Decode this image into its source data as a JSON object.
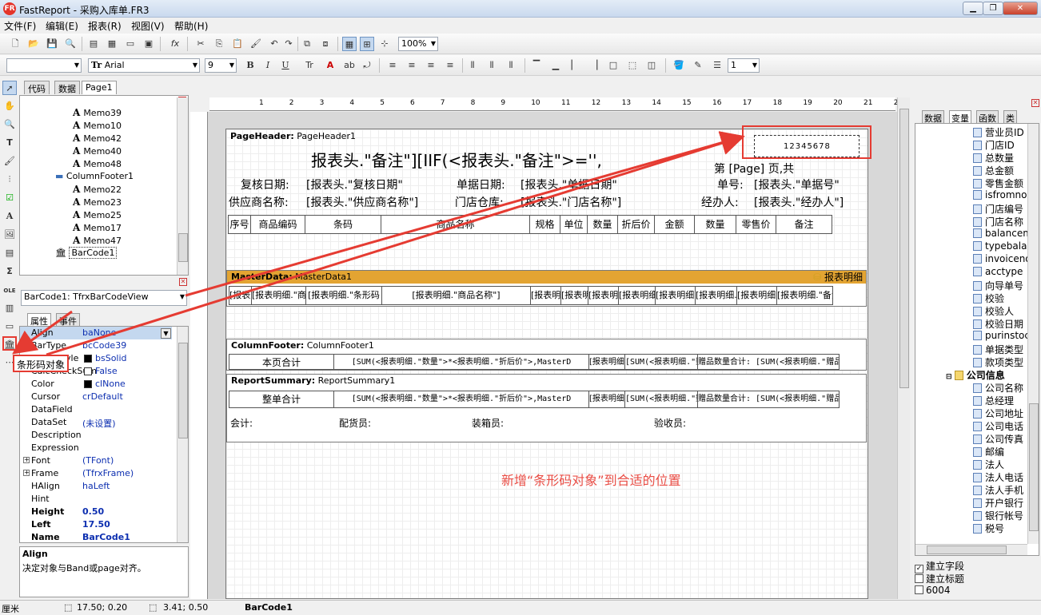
{
  "app": {
    "title": "FastReport - 采购入库单.FR3",
    "logo": "FR"
  },
  "menu": [
    "文件(F)",
    "编辑(E)",
    "报表(R)",
    "视图(V)",
    "帮助(H)"
  ],
  "toolbar1": {
    "zoom": "100%"
  },
  "toolbar2": {
    "style_value": "",
    "font": "Arial",
    "size": "9",
    "bold": "B",
    "italic": "I",
    "underline": "U",
    "line_width": "1"
  },
  "left_tabs": [
    "代码",
    "数据",
    "Page1"
  ],
  "tree_items": [
    {
      "label": "Memo39",
      "icon": "A"
    },
    {
      "label": "Memo10",
      "icon": "A"
    },
    {
      "label": "Memo42",
      "icon": "A"
    },
    {
      "label": "Memo40",
      "icon": "A"
    },
    {
      "label": "Memo48",
      "icon": "A"
    },
    {
      "label": "ColumnFooter1",
      "icon": "band"
    },
    {
      "label": "Memo22",
      "icon": "A"
    },
    {
      "label": "Memo23",
      "icon": "A"
    },
    {
      "label": "Memo25",
      "icon": "A"
    },
    {
      "label": "Memo17",
      "icon": "A"
    },
    {
      "label": "Memo47",
      "icon": "A"
    },
    {
      "label": "BarCode1",
      "icon": "barcode"
    }
  ],
  "object_selector": "BarCode1: TfrxBarCodeView",
  "prop_tabs": [
    "属性",
    "事件"
  ],
  "properties": [
    {
      "key": "Align",
      "value": "baNone"
    },
    {
      "key": "BarType",
      "value": "bcCode39"
    },
    {
      "key": "BrushStyle",
      "value": "bsSolid"
    },
    {
      "key": "CalcCheckSum",
      "value": "False"
    },
    {
      "key": "Color",
      "value": "clNone"
    },
    {
      "key": "Cursor",
      "value": "crDefault"
    },
    {
      "key": "DataField",
      "value": ""
    },
    {
      "key": "DataSet",
      "value": "(未设置)"
    },
    {
      "key": "Description",
      "value": ""
    },
    {
      "key": "Expression",
      "value": ""
    },
    {
      "key": "Font",
      "value": "(TFont)"
    },
    {
      "key": "Frame",
      "value": "(TfrxFrame)"
    },
    {
      "key": "HAlign",
      "value": "haLeft"
    },
    {
      "key": "Hint",
      "value": ""
    },
    {
      "key": "Height",
      "value": "0.50"
    },
    {
      "key": "Left",
      "value": "17.50"
    },
    {
      "key": "Name",
      "value": "BarCode1"
    }
  ],
  "help": {
    "title": "Align",
    "text": "决定对象与Band或page对齐。"
  },
  "callout": {
    "label": "条形码对象"
  },
  "ruler": [
    "1",
    "2",
    "3",
    "4",
    "5",
    "6",
    "7",
    "8",
    "9",
    "10",
    "11",
    "12",
    "13",
    "14",
    "15",
    "16",
    "17",
    "18",
    "19",
    "20",
    "21",
    "22"
  ],
  "bands": {
    "page_header": {
      "type": "PageHeader:",
      "name": "PageHeader1"
    },
    "master_data": {
      "type": "MasterData:",
      "name": "MasterData1",
      "dataset": "报表明细"
    },
    "column_footer": {
      "type": "ColumnFooter:",
      "name": "ColumnFooter1"
    },
    "report_summary": {
      "type": "ReportSummary:",
      "name": "ReportSummary1"
    }
  },
  "header_texts": {
    "title": "报表头.\"备注\"][IIF(<报表头.\"备注\">='',",
    "page_info": "第 [Page] 页,共",
    "review_date_label": "复核日期:",
    "review_date_value": "[报表头.\"复核日期\"",
    "doc_date_label": "单据日期:",
    "doc_date_value": "[报表头.\"单据日期\"",
    "doc_no_label": "单号:",
    "doc_no_value": "[报表头.\"单据号\"",
    "supplier_label": "供应商名称:",
    "supplier_value": "[报表头.\"供应商名称\"]",
    "store_label": "门店仓库:",
    "store_value": "[报表头.\"门店名称\"]",
    "handler_label": "经办人:",
    "handler_value": "[报表头.\"经办人\"]",
    "barcode_value": "12345678"
  },
  "column_headers": [
    "序号",
    "商品编码",
    "条码",
    "商品名称",
    "规格",
    "单位",
    "数量",
    "折后价",
    "金额",
    "数量",
    "零售价",
    "备注"
  ],
  "detail_cells": [
    "[报表明细",
    "[报表明细.\"商品编",
    "[报表明细.\"条形码",
    "[报表明细.\"商品名称\"]",
    "[报表明细.\"规",
    "[报表明细.\"单",
    "[报表明细.\"数",
    "[报表明细.\"折后价\"]",
    "[报表明细.\"折后金额\"]",
    "[报表明细.\"赠品",
    "[报表明细.\"零售",
    "[报表明细.\"备注"
  ],
  "footer_row": {
    "label": "本页合计",
    "sum1": "[SUM(<报表明细.\"数量\">*<报表明细.\"折后价\">,MasterD",
    "sum2": "[报表明细.\"数量\"",
    "sum3": "[SUM(<报表明细.\"数量\">,MasterData1)]",
    "sum4": "赠品数量合计: [SUM(<报表明细.\"赠品"
  },
  "summary_row": {
    "label": "整单合计",
    "sum1": "[SUM(<报表明细.\"数量\">*<报表明细.\"折后价\">,MasterD",
    "sum2": "[报表明细.\"数量\"",
    "sum3": "[SUM(<报表明细.\"数量\">,MasterData1)]",
    "sum4": "赠品数量合计: [SUM(<报表明细.\"赠品"
  },
  "signature_row": {
    "accountant": "会计:",
    "distributor": "配货员:",
    "packer": "装箱员:",
    "inspector": "验收员:"
  },
  "annotation": "新增“条形码对象”到合适的位置",
  "right_tabs": [
    "数据",
    "变量",
    "函数",
    "类"
  ],
  "var_items": [
    "营业员ID",
    "门店ID",
    "总数量",
    "总金额",
    "零售金额",
    "isfromno",
    "门店编号",
    "门店名称",
    "balancemoney",
    "typebalancemoney",
    "invoiceno",
    "acctype",
    "向导单号",
    "校验",
    "校验人",
    "校验日期",
    "purinstocheck",
    "单据类型",
    "款项类型"
  ],
  "var_group": "公司信息",
  "company_items": [
    "公司名称",
    "总经理",
    "公司地址",
    "公司电话",
    "公司传真",
    "邮编",
    "法人",
    "法人电话",
    "法人手机",
    "开户银行",
    "银行帐号",
    "税号"
  ],
  "right_checks": [
    {
      "label": "建立字段",
      "checked": true
    },
    {
      "label": "建立标题",
      "checked": false
    },
    {
      "label": "6004",
      "checked": false
    }
  ],
  "status": {
    "unit": "厘米",
    "position": "17.50; 0.20",
    "size": "3.41; 0.50",
    "object": "BarCode1"
  },
  "colors": {
    "master_band": "#e3a432",
    "callout": "#e53b32",
    "annotation": "#e94d45"
  }
}
